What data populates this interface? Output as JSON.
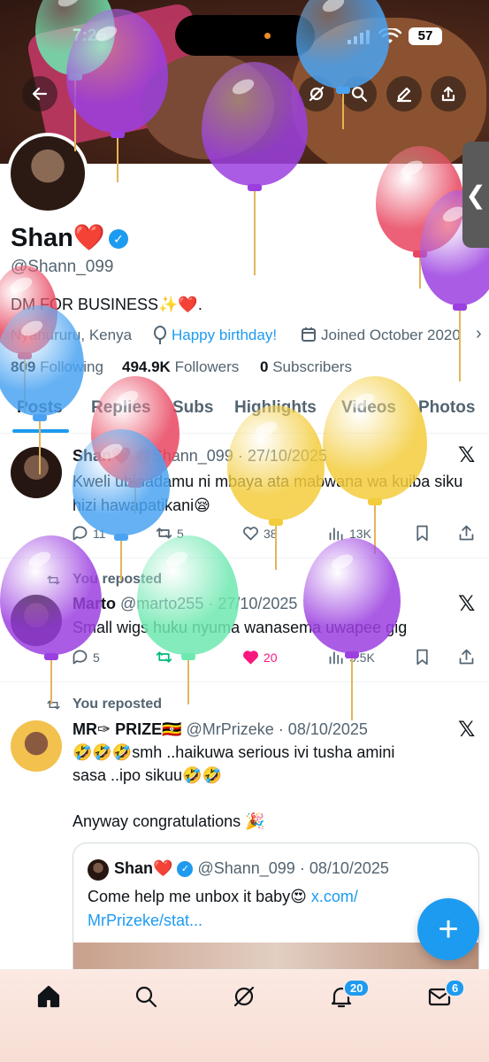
{
  "status_bar": {
    "time": "7:26",
    "battery": "57"
  },
  "header_buttons": [
    "back-arrow-icon",
    "grok-icon",
    "search-icon",
    "edit-icon",
    "share-icon"
  ],
  "profile": {
    "name": "Shan❤️",
    "handle": "@Shann_099",
    "bio": "DM FOR BUSINESS✨❤️.",
    "location": "Nyahururu, Kenya",
    "birthday": "Happy birthday!",
    "joined": "Joined October 2020",
    "following_count": "809",
    "following_label": "Following",
    "followers_count": "494.9K",
    "followers_label": "Followers",
    "subscribers_count": "0",
    "subscribers_label": "Subscribers"
  },
  "tabs": [
    "Posts",
    "Replies",
    "Subs",
    "Highlights",
    "Videos",
    "Photos"
  ],
  "tweets": [
    {
      "author": "Shan❤️",
      "handle": "@Shann_099",
      "date": "· 27/10/2025",
      "text": "Kweli ubinadamu ni mbaya ata mabwana wa kuiba siku hizi hawapatikani😪",
      "replies": "11",
      "reposts": "5",
      "likes": "38",
      "views": "13K"
    },
    {
      "repost_label": "You reposted",
      "author": "Marto",
      "handle": "@marto255",
      "date": "· 27/10/2025",
      "text": "Small wigs huku nyuma wanasema uwapee gig",
      "replies": "5",
      "reposts": "",
      "likes": "20",
      "views": "5.5K"
    },
    {
      "repost_label": "You reposted",
      "author": "MR✑ PRIZE🇺🇬",
      "handle": "@MrPrizeke",
      "date": "· 08/10/2025",
      "text_line1": "🤣🤣🤣smh ..haikuwa serious ivi tusha amini",
      "text_line2": "sasa ..ipo sikuu🤣🤣",
      "text_line3": "Anyway congratulations 🎉",
      "quote": {
        "author": "Shan❤️",
        "handle": "@Shann_099",
        "date": "· 08/10/2025",
        "text": "Come help me unbox it baby😍",
        "link_part1": "x.com/",
        "link_part2": "MrPrizeke/stat..."
      }
    }
  ],
  "x_logo": "𝕏",
  "fab_label": "+",
  "bottom_nav": {
    "notifications_badge": "20",
    "messages_badge": "6"
  },
  "side_tab_glyph": "❮",
  "colors": {
    "accent": "#1d9bf0",
    "like": "#f91880",
    "repost": "#00ba7c"
  }
}
